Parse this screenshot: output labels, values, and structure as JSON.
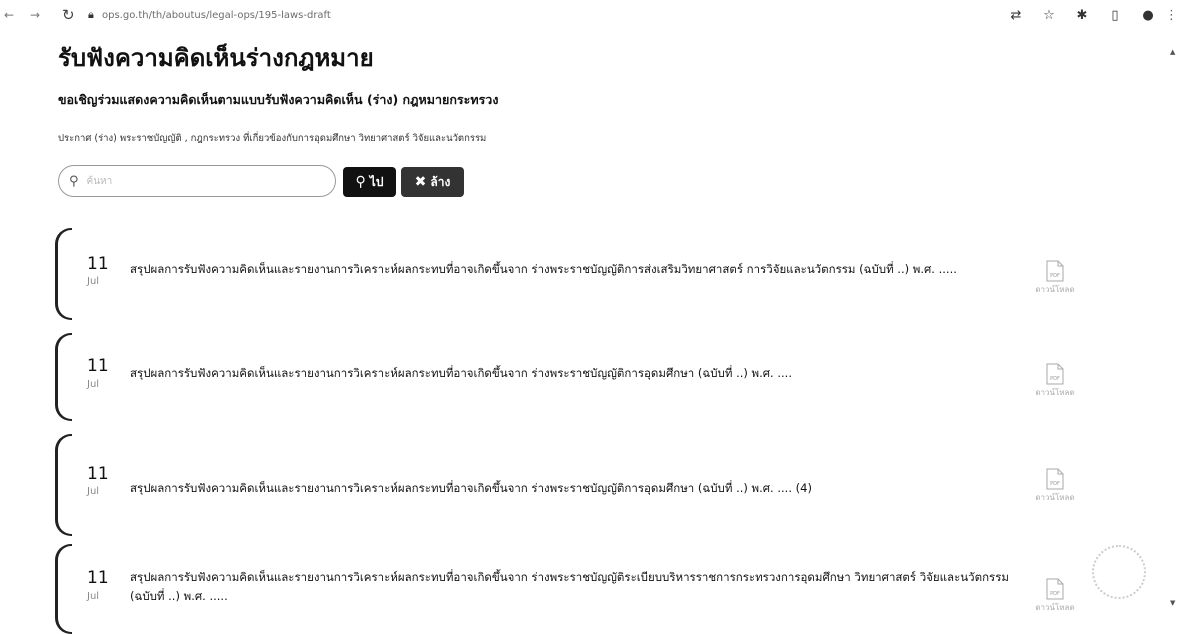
{
  "browser": {
    "url": "ops.go.th/th/aboutus/legal-ops/195-laws-draft",
    "toolbar_icons": [
      "translate-icon",
      "star-icon",
      "extension-icon",
      "sidebar-icon",
      "profile-icon"
    ]
  },
  "page": {
    "title": "รับฟังความคิดเห็นร่างกฎหมาย",
    "subtitle": "ขอเชิญร่วมแสดงความคิดเห็นตามแบบรับฟังความคิดเห็น (ร่าง) กฎหมายกระทรวง",
    "description": "ประกาศ (ร่าง) พระราชบัญญัติ , กฎกระทรวง ที่เกี่ยวข้องกับการอุดมศึกษา วิทยาศาสตร์ วิจัยและนวัตกรรม"
  },
  "search": {
    "placeholder": "ค้นหา",
    "go_label": "ไป",
    "clear_label": "ล้าง"
  },
  "items": [
    {
      "day": "11",
      "month": "Jul",
      "title": "สรุปผลการรับฟังความคิดเห็นและรายงานการวิเคราะห์ผลกระทบที่อาจเกิดขึ้นจาก ร่างพระราชบัญญัติการส่งเสริมวิทยาศาสตร์ การวิจัยและนวัตกรรม (ฉบับที่ ..) พ.ศ. .....",
      "file_type": "PDF",
      "file_label": "ดาวน์โหลด"
    },
    {
      "day": "11",
      "month": "Jul",
      "title": "สรุปผลการรับฟังความคิดเห็นและรายงานการวิเคราะห์ผลกระทบที่อาจเกิดขึ้นจาก ร่างพระราชบัญญัติการอุดมศึกษา (ฉบับที่ ..) พ.ศ. ....",
      "file_type": "PDF",
      "file_label": "ดาวน์โหลด"
    },
    {
      "day": "11",
      "month": "Jul",
      "title": "สรุปผลการรับฟังความคิดเห็นและรายงานการวิเคราะห์ผลกระทบที่อาจเกิดขึ้นจาก ร่างพระราชบัญญัติการอุดมศึกษา (ฉบับที่ ..) พ.ศ. .... (4)",
      "file_type": "PDF",
      "file_label": "ดาวน์โหลด"
    },
    {
      "day": "11",
      "month": "Jul",
      "title": "สรุปผลการรับฟังความคิดเห็นและรายงานการวิเคราะห์ผลกระทบที่อาจเกิดขึ้นจาก ร่างพระราชบัญญัติระเบียบบริหารราชการกระทรวงการอุดมศึกษา วิทยาศาสตร์ วิจัยและนวัตกรรม (ฉบับที่ ..) พ.ศ. .....",
      "file_type": "PDF",
      "file_label": "ดาวน์โหลด"
    }
  ]
}
